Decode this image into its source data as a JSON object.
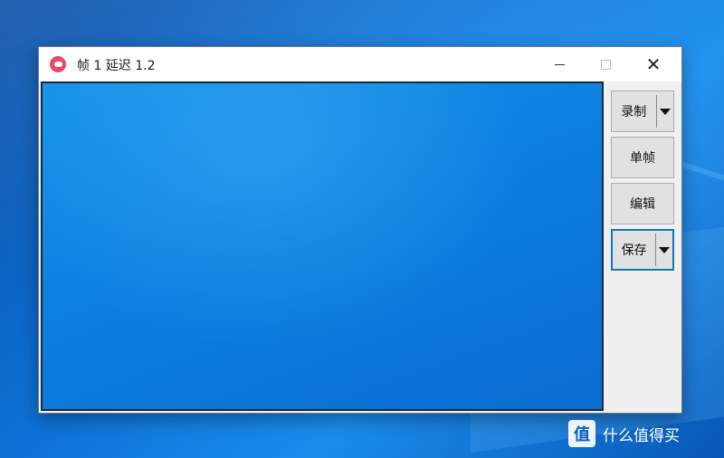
{
  "window": {
    "title": "帧 1 延迟 1.2",
    "controls": {
      "minimize": "minimize-icon",
      "maximize": "maximize-icon",
      "close": "close-icon",
      "close_glyph": "✕"
    }
  },
  "toolbar": {
    "record_label": "录制",
    "single_frame_label": "单帧",
    "edit_label": "编辑",
    "save_label": "保存"
  },
  "watermark": {
    "badge": "值",
    "text": "什么值得买"
  },
  "colors": {
    "app_icon": "#e8486a",
    "desktop": "#0d72d6",
    "save_border": "#0f7ab8"
  }
}
